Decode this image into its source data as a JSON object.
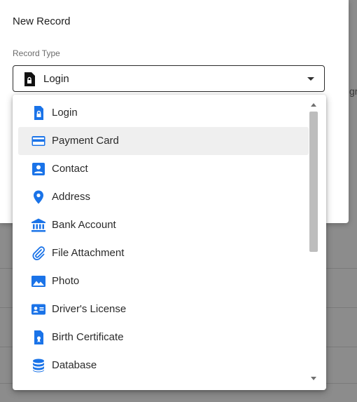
{
  "dialog": {
    "title": "New Record",
    "field_label": "Record Type",
    "selected_value": "Login"
  },
  "background": {
    "partial_text": "gr"
  },
  "menu": {
    "items": [
      {
        "label": "Login",
        "icon": "login-lock-icon"
      },
      {
        "label": "Payment Card",
        "icon": "credit-card-icon"
      },
      {
        "label": "Contact",
        "icon": "contact-person-icon"
      },
      {
        "label": "Address",
        "icon": "location-pin-icon"
      },
      {
        "label": "Bank Account",
        "icon": "bank-icon"
      },
      {
        "label": "File Attachment",
        "icon": "paperclip-icon"
      },
      {
        "label": "Photo",
        "icon": "photo-icon"
      },
      {
        "label": "Driver's License",
        "icon": "id-card-icon"
      },
      {
        "label": "Birth Certificate",
        "icon": "certificate-icon"
      },
      {
        "label": "Database",
        "icon": "database-icon"
      }
    ],
    "hovered_index": 1
  },
  "colors": {
    "accent": "#1a73e8",
    "text": "#2a2a2a",
    "hover": "#efefef"
  }
}
